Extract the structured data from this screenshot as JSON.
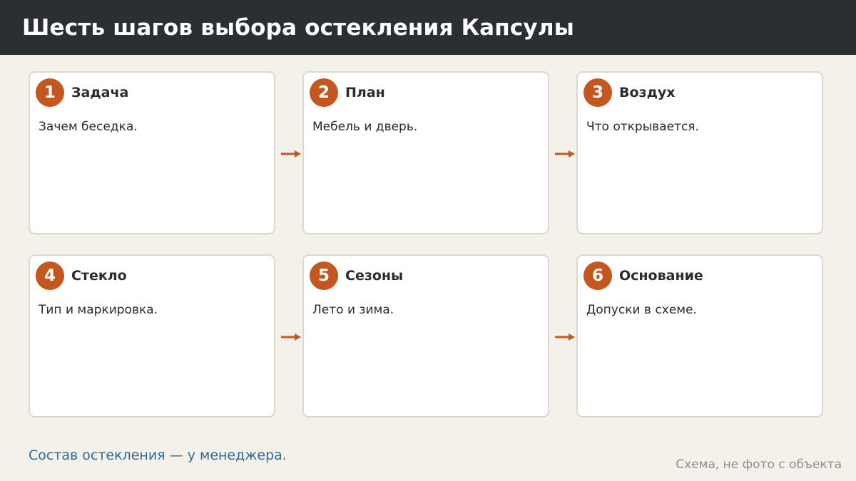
{
  "header": {
    "title": "Шесть шагов выбора остекления Капсулы"
  },
  "steps": [
    {
      "number": "1",
      "title": "Задача",
      "text": "Зачем беседка."
    },
    {
      "number": "2",
      "title": "План",
      "text": "Мебель и дверь."
    },
    {
      "number": "3",
      "title": "Воздух",
      "text": "Что открывается."
    },
    {
      "number": "4",
      "title": "Стекло",
      "text": "Тип и маркировка."
    },
    {
      "number": "5",
      "title": "Сезоны",
      "text": "Лето и зима."
    },
    {
      "number": "6",
      "title": "Основание",
      "text": "Допуски в схеме."
    }
  ],
  "footer": {
    "note": "Состав остекления — у менеджера.",
    "caption": "Схема, не фото с объекта"
  },
  "colors": {
    "header_bg": "#2b2e33",
    "accent": "#c4561f",
    "note_text": "#2f6a94",
    "page_bg": "#f4f1eb"
  },
  "icons": {
    "connector": "arrow-right-icon"
  }
}
